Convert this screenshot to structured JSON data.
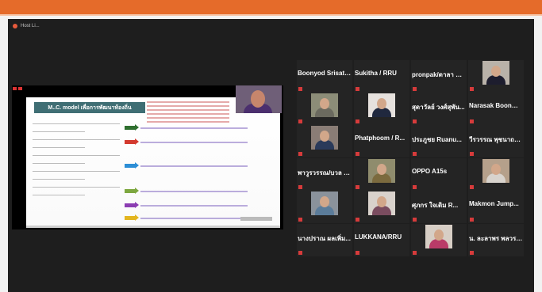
{
  "window": {
    "title": "Host Li..."
  },
  "participants": [
    {
      "name": "Boonyod Srisato...",
      "type": "name"
    },
    {
      "name": "Sukitha / RRU",
      "type": "name"
    },
    {
      "name": "pronpak/ดาลา พร...",
      "type": "name"
    },
    {
      "name": "",
      "type": "photo",
      "body": "#1d1d2e",
      "bg": "#b9b2a9",
      "label": ""
    },
    {
      "name": "",
      "type": "photo",
      "body": "#6b6a5f",
      "bg": "#8c8d78",
      "label": ""
    },
    {
      "name": "",
      "type": "photo",
      "body": "#20283e",
      "bg": "#e6e1dd",
      "label": ""
    },
    {
      "name": "สุดาวัลย์ วงศ์สุพัน...",
      "type": "name"
    },
    {
      "name": "Narasak Boonme...",
      "type": "name"
    },
    {
      "name": "",
      "type": "photo",
      "body": "#2a3a5a",
      "bg": "#8a7d76",
      "label": ""
    },
    {
      "name": "Phatphoom / R...",
      "type": "name"
    },
    {
      "name": "ประภูชย Ruanu...",
      "type": "name"
    },
    {
      "name": "วีรวรรณ พุชนาถไวล...",
      "type": "name"
    },
    {
      "name": "พาวูรวรรณ/บวล ร...",
      "type": "name"
    },
    {
      "name": "",
      "type": "photo",
      "body": "#7b6a3e",
      "bg": "#8f8c6d",
      "label": ""
    },
    {
      "name": "OPPO A15s",
      "type": "name"
    },
    {
      "name": "",
      "type": "photo",
      "body": "#d8d3cd",
      "bg": "#b5a08b",
      "label": ""
    },
    {
      "name": "",
      "type": "photo",
      "body": "#5b7c9a",
      "bg": "#8a929b",
      "label": ""
    },
    {
      "name": "",
      "type": "photo",
      "body": "#7a4c5f",
      "bg": "#d9d2cc",
      "label": ""
    },
    {
      "name": "ศุภกร ใจเดิม R...",
      "type": "name"
    },
    {
      "name": "Makmon Jump...",
      "type": "name"
    },
    {
      "name": "นางปราณ ผลเพิ่ม...",
      "type": "name"
    },
    {
      "name": "LUKKANA/RRU",
      "type": "name"
    },
    {
      "name": "",
      "type": "photo",
      "body": "#b93b68",
      "bg": "#d7cec5",
      "label": ""
    },
    {
      "name": "น. ละลาพร พลวรร...",
      "type": "name"
    }
  ],
  "slide": {
    "title": "M..C. model เพื่อการพัฒนาท้องถิ่น"
  },
  "colors": {
    "accent": "#e56b2a",
    "background": "#1e1e1e",
    "tile": "#242424"
  }
}
